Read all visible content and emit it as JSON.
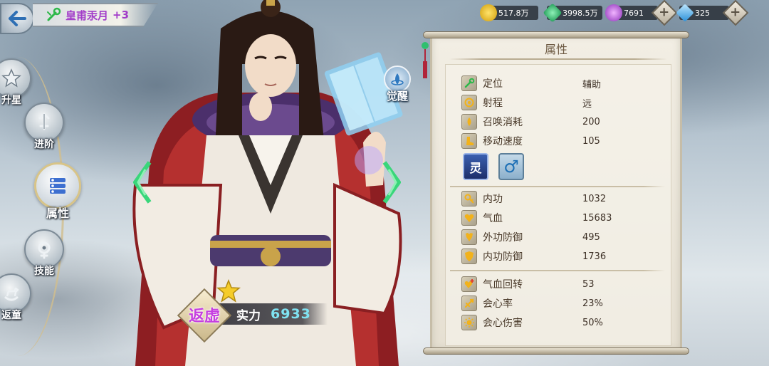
{
  "header": {
    "hero_name": "皇甫汞月",
    "hero_level": "+3"
  },
  "resources": [
    {
      "name": "gold",
      "value": "517.8万",
      "color": "#f2c21a"
    },
    {
      "name": "jade",
      "value": "3998.5万",
      "color": "#2fbf6f"
    },
    {
      "name": "spirit-orb",
      "value": "7691",
      "color": "#b45ad6"
    },
    {
      "name": "diamond",
      "value": "325",
      "color": "#4ab4f0"
    }
  ],
  "side_menu": {
    "items": [
      {
        "id": "star-up",
        "label": "升星",
        "icon": "star-icon"
      },
      {
        "id": "advance",
        "label": "进阶",
        "icon": "sword-up-icon"
      },
      {
        "id": "attributes",
        "label": "属性",
        "icon": "list-icon",
        "active": true
      },
      {
        "id": "skills",
        "label": "技能",
        "icon": "skill-icon"
      },
      {
        "id": "rebirth",
        "label": "返童",
        "icon": "rocking-horse-icon"
      }
    ]
  },
  "hero": {
    "awaken_label": "觉醒",
    "quality_text": "返虚",
    "power_label": "实力",
    "power_value": "6933"
  },
  "panel": {
    "title": "属性",
    "basic": [
      {
        "label": "定位",
        "value": "辅助",
        "icon": "role-icon"
      },
      {
        "label": "射程",
        "value": "远",
        "icon": "target-icon"
      },
      {
        "label": "召唤消耗",
        "value": "200",
        "icon": "drop-icon"
      },
      {
        "label": "移动速度",
        "value": "105",
        "icon": "boot-icon"
      }
    ],
    "tags": {
      "faction": "灵",
      "gender": "♂"
    },
    "combat": [
      {
        "label": "内功",
        "value": "1032",
        "icon": "key-icon"
      },
      {
        "label": "气血",
        "value": "15683",
        "icon": "heart-icon"
      },
      {
        "label": "外功防御",
        "value": "495",
        "icon": "armor-icon"
      },
      {
        "label": "内功防御",
        "value": "1736",
        "icon": "shield-icon"
      }
    ],
    "extra": [
      {
        "label": "气血回转",
        "value": "53",
        "icon": "heart-plus-icon"
      },
      {
        "label": "会心率",
        "value": "23%",
        "icon": "crit-icon"
      },
      {
        "label": "会心伤害",
        "value": "50%",
        "icon": "sun-icon"
      }
    ]
  },
  "colors": {
    "hero_name": "#a23cc9",
    "power_value": "#7fe3f2",
    "accent_green": "#3fd07a"
  }
}
